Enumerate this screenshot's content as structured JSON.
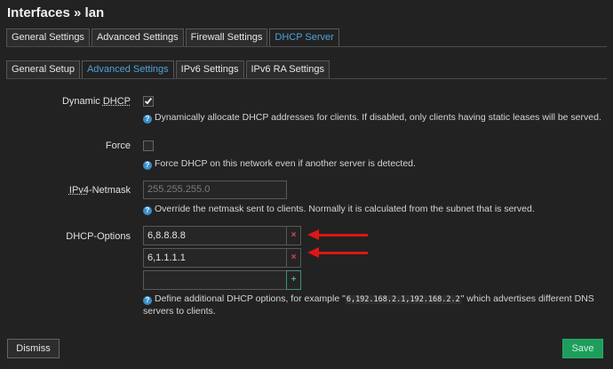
{
  "page": {
    "title": "Interfaces » lan"
  },
  "main_tabs": [
    {
      "label": "General Settings",
      "active": false
    },
    {
      "label": "Advanced Settings",
      "active": false
    },
    {
      "label": "Firewall Settings",
      "active": false
    },
    {
      "label": "DHCP Server",
      "active": true
    }
  ],
  "sub_tabs": [
    {
      "label": "General Setup",
      "active": false
    },
    {
      "label": "Advanced Settings",
      "active": true
    },
    {
      "label": "IPv6 Settings",
      "active": false
    },
    {
      "label": "IPv6 RA Settings",
      "active": false
    }
  ],
  "fields": {
    "dynamic_dhcp": {
      "label_text": "Dynamic ",
      "label_abbr": "DHCP",
      "checked": true,
      "help": "Dynamically allocate DHCP addresses for clients. If disabled, only clients having static leases will be served."
    },
    "force": {
      "label": "Force",
      "checked": false,
      "help": "Force DHCP on this network even if another server is detected."
    },
    "netmask": {
      "label_abbr": "IPv4",
      "label_text": "-Netmask",
      "placeholder": "255.255.255.0",
      "help": "Override the netmask sent to clients. Normally it is calculated from the subnet that is served."
    },
    "dhcp_options": {
      "label": "DHCP-Options",
      "values": [
        "6,8.8.8.8",
        "6,1.1.1.1"
      ],
      "new_value": "",
      "help_prefix": "Define additional DHCP options, for example \"",
      "help_code": "6,192.168.2.1,192.168.2.2",
      "help_suffix": "\" which advertises different DNS",
      "help_line2": "servers to clients."
    }
  },
  "icons": {
    "help": "help-circle-icon",
    "remove": "×",
    "add": "+"
  },
  "colors": {
    "accent": "#4ea2d8",
    "save": "#1f9d5c",
    "remove": "#e04545",
    "annotation_arrow": "#e01515"
  },
  "footer": {
    "dismiss_label": "Dismiss",
    "save_label": "Save"
  }
}
